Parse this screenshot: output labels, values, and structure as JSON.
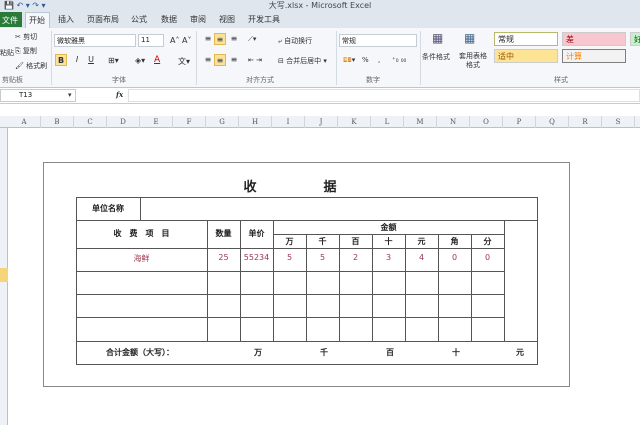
{
  "window": {
    "title": "大写.xlsx - Microsoft Excel"
  },
  "tabs": [
    "文件",
    "开始",
    "插入",
    "页面布局",
    "公式",
    "数据",
    "审阅",
    "视图",
    "开发工具"
  ],
  "ribbon": {
    "clipboard": {
      "paste": "粘贴",
      "cut": "剪切",
      "copy": "复制",
      "format_painter": "格式刷",
      "label": "剪贴板"
    },
    "font": {
      "name": "微软雅黑",
      "size": "11",
      "bold": "B",
      "italic": "I",
      "underline": "U",
      "label": "字体"
    },
    "alignment": {
      "wrap": "自动换行",
      "merge": "合并后居中",
      "label": "对齐方式"
    },
    "number": {
      "format": "常规",
      "percent": "%",
      "comma": ",",
      "label": "数字"
    },
    "styles": {
      "conditional": "条件格式",
      "table": "套用表格格式",
      "cells": [
        "常规",
        "差",
        "好",
        "适中",
        "计算"
      ],
      "label": "样式"
    }
  },
  "formula_bar": {
    "name_box": "T13",
    "fx": "fx",
    "value": ""
  },
  "columns": [
    "A",
    "B",
    "C",
    "D",
    "E",
    "F",
    "G",
    "H",
    "I",
    "J",
    "K",
    "L",
    "M",
    "N",
    "O",
    "P",
    "Q",
    "R",
    "S"
  ],
  "receipt": {
    "title_a": "收",
    "title_b": "据",
    "unit_label": "单位名称",
    "item_header": "收　费　项　目",
    "qty_header": "数量",
    "price_header": "单价",
    "amount_header": "金额",
    "digits": [
      "万",
      "千",
      "百",
      "十",
      "元",
      "角",
      "分"
    ],
    "row": {
      "item": "海鲜",
      "qty": "25",
      "price": "55234",
      "amount": [
        "5",
        "5",
        "2",
        "3",
        "4",
        "0",
        "0"
      ]
    },
    "total_label": "合计金额（大写）：",
    "total_units": [
      "万",
      "千",
      "百",
      "十",
      "元"
    ]
  }
}
